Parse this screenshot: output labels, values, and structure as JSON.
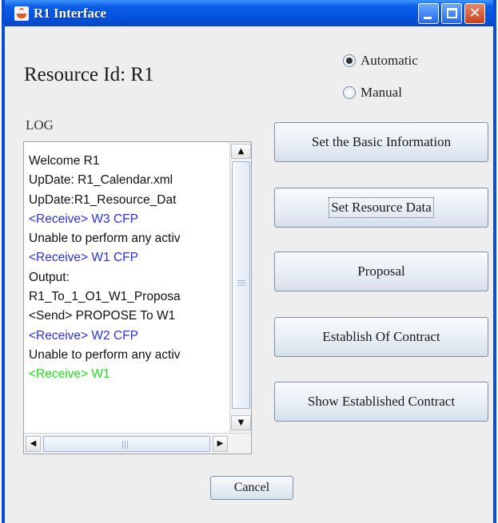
{
  "window": {
    "title": "R1 Interface",
    "icon": "java-cup-icon",
    "controls": [
      "minimize-icon",
      "maximize-icon",
      "close-icon"
    ],
    "close_glyph": "✕",
    "colors": {
      "titlebar": "#0551dc",
      "close": "#c8401c"
    }
  },
  "resource": {
    "label": "Resource Id:  R1"
  },
  "mode": {
    "options": [
      {
        "label": "Automatic",
        "selected": true
      },
      {
        "label": "Manual",
        "selected": false
      }
    ]
  },
  "log": {
    "label": "LOG",
    "lines": [
      {
        "text": "Welcome R1",
        "color": "#111111"
      },
      {
        "text": "UpDate: R1_Calendar.xml",
        "color": "#111111"
      },
      {
        "text": "UpDate:R1_Resource_Dat",
        "color": "#111111"
      },
      {
        "text": "<Receive> W3 CFP",
        "color": "#2d31e4"
      },
      {
        "text": "Unable to perform any activ",
        "color": "#111111"
      },
      {
        "text": "<Receive> W1 CFP",
        "color": "#2d31e4"
      },
      {
        "text": "Output:",
        "color": "#111111"
      },
      {
        "text": "R1_To_1_O1_W1_Proposa",
        "color": "#111111"
      },
      {
        "text": "<Send> PROPOSE To W1",
        "color": "#111111"
      },
      {
        "text": "<Receive> W2 CFP",
        "color": "#2d31e4"
      },
      {
        "text": "Unable to perform any activ",
        "color": "#111111"
      },
      {
        "text": "<Receive> W1",
        "color": "#21e021"
      }
    ],
    "scroll": {
      "up": "▲",
      "down": "▼",
      "left": "◀",
      "right": "▶"
    }
  },
  "actions": [
    {
      "label": "Set the Basic Information"
    },
    {
      "label": "Set Resource Data"
    },
    {
      "label": "Proposal"
    },
    {
      "label": "Establish Of Contract"
    },
    {
      "label": "Show Established Contract"
    }
  ],
  "cancel": {
    "label": "Cancel"
  }
}
